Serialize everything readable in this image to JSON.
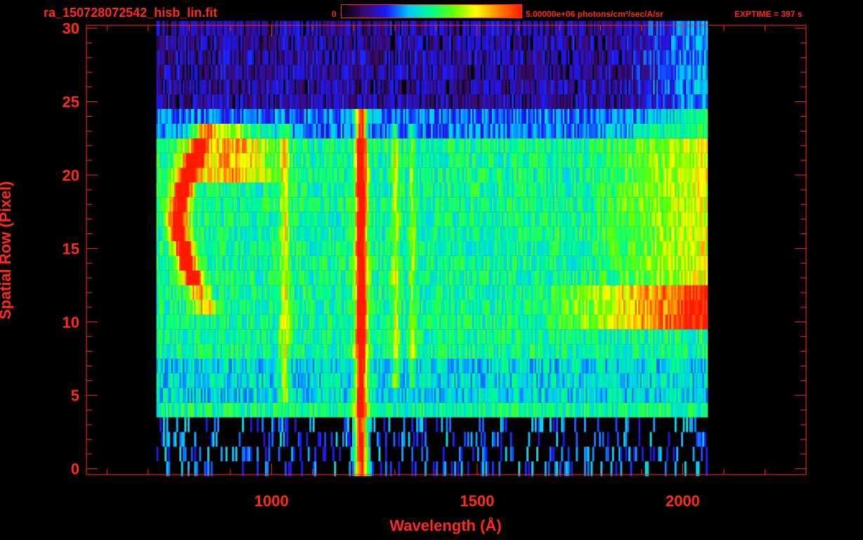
{
  "header": {
    "file_title": "ra_150728072542_hisb_lin.fit",
    "colorbar_min": "0",
    "colorbar_max": "5.00000e+06 photons/cm²/sec/A/sr",
    "exptime": "EXPTIME = 397 s"
  },
  "colors": {
    "text": "#ff2a1a",
    "axis": "#ff2a1a",
    "background": "#000000",
    "colormap": [
      "#000000",
      "#3a0a6e",
      "#1a1aff",
      "#00c8ff",
      "#00ff88",
      "#66ff00",
      "#ffff00",
      "#ff8000",
      "#ff1a00"
    ]
  },
  "chart_data": {
    "type": "heatmap",
    "xlabel": "Wavelength (Å)",
    "ylabel": "Spatial Row (Pixel)",
    "xlim": [
      550,
      2300
    ],
    "ylim": [
      -0.4,
      30.2
    ],
    "x_ticks": [
      1000,
      1500,
      2000
    ],
    "y_ticks": [
      0,
      5,
      10,
      15,
      20,
      25,
      30
    ],
    "data_x_range": [
      720,
      2060
    ],
    "features": [
      {
        "description": "strong emission line",
        "x": 1216,
        "rows": [
          0,
          24
        ],
        "level": 0.95
      },
      {
        "description": "emission arc",
        "x": 760,
        "rows": [
          11,
          23
        ],
        "level": 0.9
      },
      {
        "description": "continuum band",
        "x_range": [
          1750,
          2060
        ],
        "rows": [
          10,
          12
        ],
        "level": 0.85
      }
    ],
    "grid": false
  }
}
